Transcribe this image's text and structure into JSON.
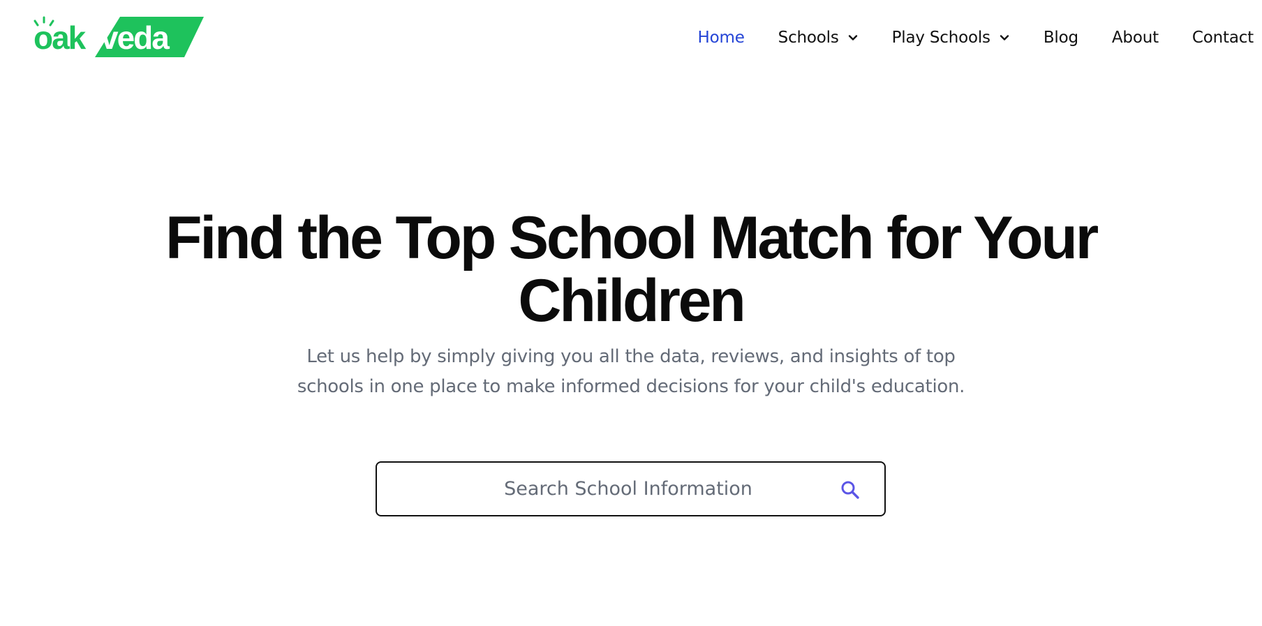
{
  "brand": {
    "logo_text": "oakveda",
    "color": "#1ec25c"
  },
  "nav": {
    "items": [
      {
        "label": "Home",
        "active": true,
        "dropdown": false
      },
      {
        "label": "Schools",
        "active": false,
        "dropdown": true
      },
      {
        "label": "Play Schools",
        "active": false,
        "dropdown": true
      },
      {
        "label": "Blog",
        "active": false,
        "dropdown": false
      },
      {
        "label": "About",
        "active": false,
        "dropdown": false
      },
      {
        "label": "Contact",
        "active": false,
        "dropdown": false
      }
    ],
    "active_color": "#2444d6"
  },
  "hero": {
    "title_line1": "Find the Top School Match for Your",
    "title_line2": "Children",
    "subtitle_line1": "Let us help by simply giving you all the data, reviews, and insights of top",
    "subtitle_line2": "schools in one place to make informed decisions for your child's education."
  },
  "search": {
    "placeholder": "Search School Information",
    "value": "",
    "icon": "search-icon",
    "icon_color": "#5b55e6"
  }
}
